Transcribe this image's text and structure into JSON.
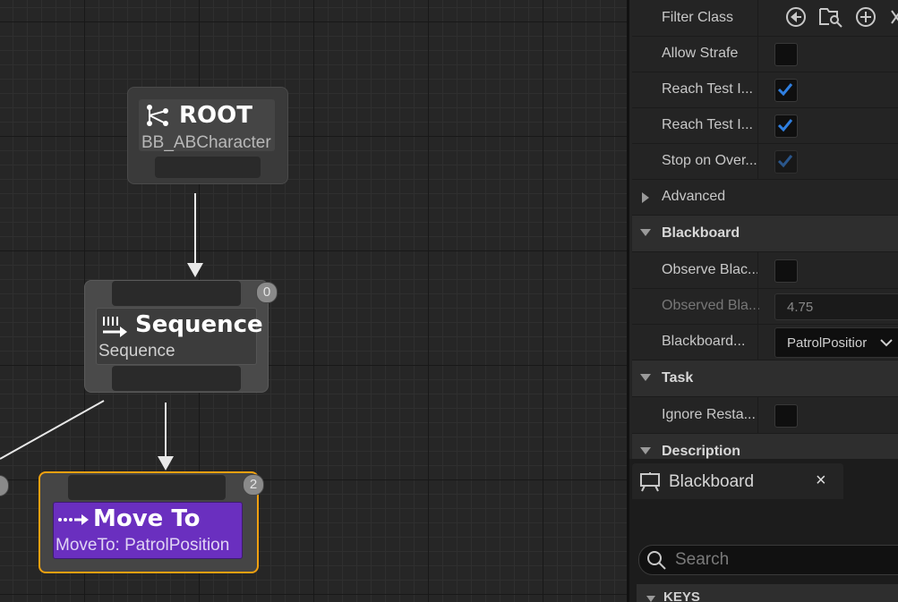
{
  "graph": {
    "root": {
      "title": "ROOT",
      "subtitle": "BB_ABCharacter"
    },
    "sequence": {
      "title": "Sequence",
      "subtitle": "Sequence",
      "order": "0"
    },
    "moveto": {
      "title": "Move To",
      "subtitle": "MoveTo: PatrolPosition",
      "order": "2"
    }
  },
  "details": {
    "rows": [
      {
        "label": "Filter Class"
      },
      {
        "label": "Allow Strafe",
        "checked": false
      },
      {
        "label": "Reach Test I...",
        "checked": true
      },
      {
        "label": "Reach Test I...",
        "checked": true
      },
      {
        "label": "Stop on Over...",
        "checked": true
      }
    ],
    "advanced": "Advanced",
    "blackboard_cat": "Blackboard",
    "observe_label": "Observe Blac...",
    "observed_label": "Observed Bla...",
    "observed_value": "4.75",
    "bbkey_label": "Blackboard...",
    "bbkey_value": "PatrolPositior",
    "task_cat": "Task",
    "ignore_label": "Ignore Resta...",
    "description_cat": "Description"
  },
  "blackboard_panel": {
    "tab_label": "Blackboard",
    "close": "×",
    "search_placeholder": "Search",
    "keys_label": "KEYS"
  },
  "colors": {
    "accent": "#2f7fe0",
    "moveto_purple": "#6a2fbf",
    "selection_orange": "#f0a010"
  }
}
